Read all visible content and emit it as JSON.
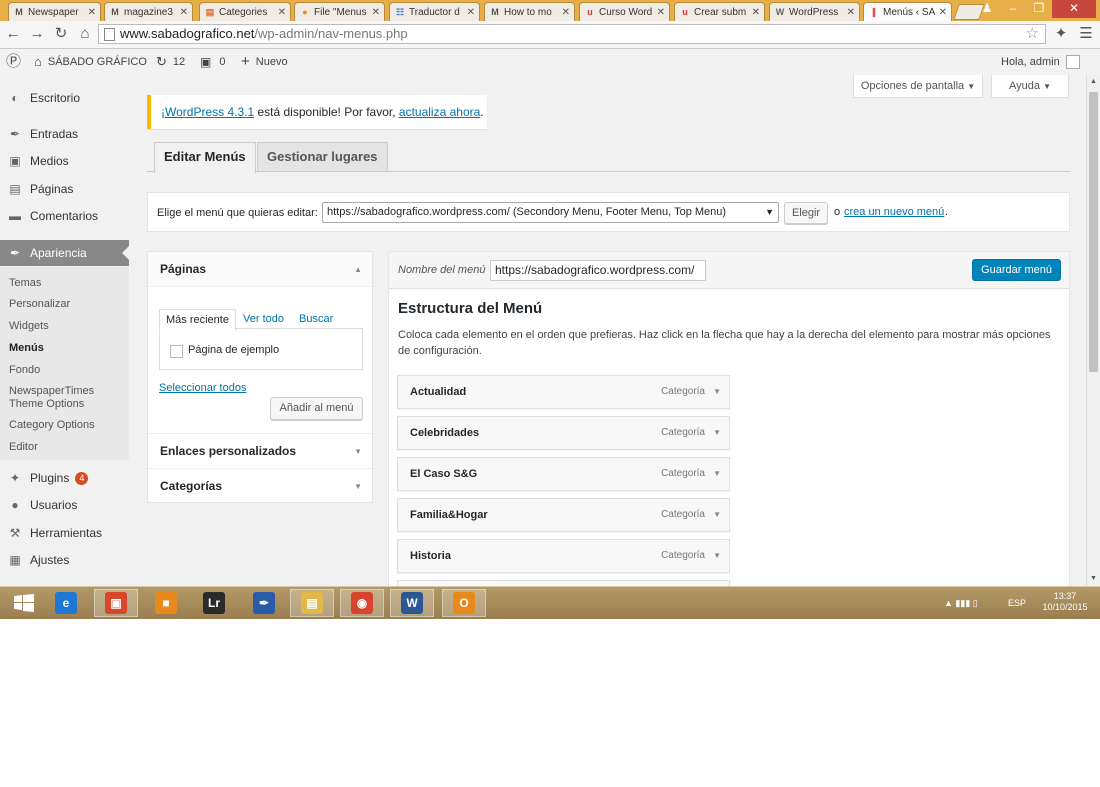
{
  "browser": {
    "tabs": [
      {
        "label": "Newspaper",
        "icon": "M",
        "color": "#555"
      },
      {
        "label": "magazine3",
        "icon": "M",
        "color": "#555"
      },
      {
        "label": "Categories",
        "icon": "▤",
        "color": "#e06a2b"
      },
      {
        "label": "File \"Menus",
        "icon": "●",
        "color": "#e58b1f"
      },
      {
        "label": "Traductor d",
        "icon": "☷",
        "color": "#4a7bd4"
      },
      {
        "label": "How to mo",
        "icon": "M",
        "color": "#555"
      },
      {
        "label": "Curso Word",
        "icon": "u",
        "color": "#d33"
      },
      {
        "label": "Crear subm",
        "icon": "u",
        "color": "#d33"
      },
      {
        "label": "WordPress",
        "icon": "W",
        "color": "#666"
      },
      {
        "label": "Menús ‹ SÁ",
        "icon": "∥",
        "color": "#d33",
        "active": true
      }
    ],
    "url_host": "www.sabadografico.net",
    "url_path": "/wp-admin/nav-menus.php"
  },
  "adminbar": {
    "site_name": "SÁBADO GRÁFICO",
    "updates_count": "12",
    "comments_count": "0",
    "new_label": "Nuevo",
    "greeting": "Hola, admin"
  },
  "sidebar": {
    "items": [
      {
        "label": "Escritorio",
        "icon": "◐"
      },
      {
        "label": "Entradas",
        "icon": "✒"
      },
      {
        "label": "Medios",
        "icon": "▣"
      },
      {
        "label": "Páginas",
        "icon": "▤"
      },
      {
        "label": "Comentarios",
        "icon": "▬"
      },
      {
        "label": "Apariencia",
        "icon": "✒"
      },
      {
        "label": "Plugins",
        "icon": "✦",
        "badge": "4"
      },
      {
        "label": "Usuarios",
        "icon": "●"
      },
      {
        "label": "Herramientas",
        "icon": "⚒"
      },
      {
        "label": "Ajustes",
        "icon": "▦"
      }
    ],
    "submenu": [
      "Temas",
      "Personalizar",
      "Widgets",
      "Menús",
      "Fondo",
      "NewspaperTimes",
      "Theme Options",
      "Category Options",
      "Editor"
    ]
  },
  "screen_options": {
    "label": "Opciones de pantalla",
    "help": "Ayuda"
  },
  "notice": {
    "link1": "¡WordPress 4.3.1",
    "mid": " está disponible! Por favor, ",
    "link2": "actualiza ahora",
    "end": "."
  },
  "nav_tabs": {
    "edit": "Editar Menús",
    "locations": "Gestionar lugares"
  },
  "select_menu": {
    "label": "Elige el menú que quieras editar:",
    "selected": "https://sabadografico.wordpress.com/ (Secondory Menu, Footer Menu, Top Menu)",
    "button": "Elegir",
    "or": "o",
    "create_link": "crea un nuevo menú",
    "period": "."
  },
  "accordion": {
    "pages_title": "Páginas",
    "tabs": [
      "Más reciente",
      "Ver todo",
      "Buscar"
    ],
    "checkbox_label": "Página de ejemplo",
    "select_all": "Seleccionar todos",
    "add_button": "Añadir al menú",
    "links_title": "Enlaces personalizados",
    "categories_title": "Categorías"
  },
  "menu_editor": {
    "name_label": "Nombre del menú",
    "name_value": "https://sabadografico.wordpress.com/",
    "save_button": "Guardar menú",
    "structure_title": "Estructura del Menú",
    "instructions": "Coloca cada elemento en el orden que prefieras. Haz click en la flecha que hay a la derecha del elemento para mostrar más opciones de configuración.",
    "items": [
      {
        "title": "Actualidad",
        "type": "Categoría"
      },
      {
        "title": "Celebridades",
        "type": "Categoría"
      },
      {
        "title": "El Caso S&G",
        "type": "Categoría"
      },
      {
        "title": "Familia&Hogar",
        "type": "Categoría"
      },
      {
        "title": "Historia",
        "type": "Categoría"
      }
    ]
  },
  "taskbar": {
    "apps": [
      {
        "label": "",
        "icon": "e",
        "color": "#1e77d3"
      },
      {
        "label": "",
        "icon": "▣",
        "color": "#d9472b"
      },
      {
        "label": "",
        "icon": "■",
        "color": "#e8891d"
      },
      {
        "label": "",
        "icon": "Lr",
        "color": "#2b2b2b"
      },
      {
        "label": "",
        "icon": "✒",
        "color": "#2a5aa8"
      },
      {
        "label": "",
        "icon": "▤",
        "color": "#e2b84a"
      },
      {
        "label": "",
        "icon": "◉",
        "color": "#d9442e"
      },
      {
        "label": "",
        "icon": "W",
        "color": "#2b5797"
      },
      {
        "label": "",
        "icon": "O",
        "color": "#e8891d"
      }
    ],
    "language": "ESP",
    "time": "13:37",
    "date": "10/10/2015"
  }
}
